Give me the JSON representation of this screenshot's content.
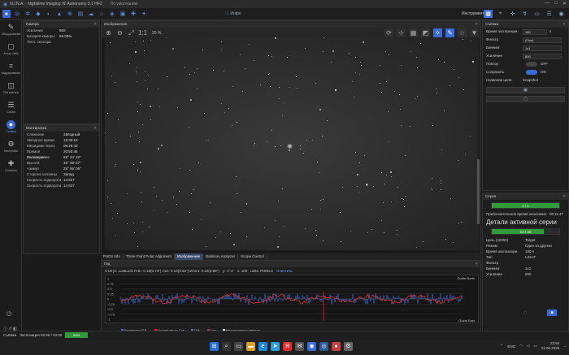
{
  "app": {
    "title": "N.I.N.A. - Nighttime Imaging 'N' Astronomy 3.1 HF2",
    "subtitle": "По умолчанию"
  },
  "toolbar": {
    "info_label": "Инфо",
    "instruments_label": "Инструменты"
  },
  "sidebar": {
    "items": [
      {
        "label": "Оборудование"
      },
      {
        "label": "Атлас неба"
      },
      {
        "label": "Кадрирование"
      },
      {
        "label": "Flat мастер"
      },
      {
        "label": "Серия"
      },
      {
        "label": "Съёмка"
      },
      {
        "label": "Настройки"
      },
      {
        "label": "Плагины"
      }
    ],
    "active_index": 5
  },
  "camera_panel": {
    "title": "Камера",
    "rows": [
      {
        "k": "Усиление",
        "v": "800"
      },
      {
        "k": "Батарея камеры",
        "v": "65.00%"
      },
      {
        "k": "Тепл. сенсора",
        "v": ""
      }
    ]
  },
  "mount_panel": {
    "title": "Монтировка",
    "rows": [
      {
        "k": "Слежение",
        "v": "Звёздный"
      },
      {
        "k": "Звёздное время",
        "v": "15:30:19"
      },
      {
        "k": "Меридиан через",
        "v": "05:28:40"
      },
      {
        "k": "Прямое Восхождение",
        "v": "20:50:45"
      },
      {
        "k": "Склонение",
        "v": "69° 34' 22\""
      },
      {
        "k": "Высота",
        "v": "46° 08' 57\""
      },
      {
        "k": "Азимут",
        "v": "29° 56' 06\""
      },
      {
        "k": "Сторона колонны",
        "v": "Запад"
      },
      {
        "k": "Скорость подворота",
        "v": "13.537"
      },
      {
        "k": "Скорость подворота",
        "v": "13.537"
      }
    ]
  },
  "image_panel": {
    "title": "Изображение",
    "zoom_label": "1:1",
    "zoom_value": "20 %"
  },
  "tabs": [
    {
      "label": "PHD2 Info",
      "active": false
    },
    {
      "label": "Three Point Polar Alignment",
      "active": false
    },
    {
      "label": "Изображение",
      "active": true
    },
    {
      "label": "Bahtinov Analyzer",
      "active": false
    },
    {
      "label": "Scope Control",
      "active": false
    }
  ],
  "guider": {
    "title": "Гид",
    "stats": "Статус: LostLock  П.В.: 0.18(0.73\")  Скл: 0.13(0.52\")  Итого: 0.22(0.89\")",
    "y_scale": "y: +/-1\"",
    "x_scale": "x: 100",
    "units": "units: PIXELS",
    "clear_label": "Очистить",
    "north_label": "Guide North",
    "east_label": "Guide East",
    "y_ticks": [
      "1",
      "0.75",
      "0.5",
      "0.25",
      "0",
      "-0.25",
      "-0.5",
      "-0.75",
      "-1"
    ],
    "legend": [
      {
        "label": "Коррекция П.В.",
        "color": "#3a6ad8"
      },
      {
        "label": "Коррекция по Скл",
        "color": "#c83030"
      },
      {
        "label": "П.В.",
        "color": "#3a6ad8"
      },
      {
        "label": "Скл",
        "color": "#c83030"
      },
      {
        "label": "Меандровая подвижка",
        "color": "#ffffff"
      }
    ]
  },
  "camera_right": {
    "title": "Съёмка",
    "exposure_label": "Время экспозиции",
    "exposure_value": "180",
    "exposure_unit": "s",
    "filter_label": "Фильтр",
    "filter_value": "(Fixe)",
    "binning_label": "Биннинг",
    "binning_value": "1x1",
    "gain_label": "Усиление",
    "gain_value": "800",
    "loop_label": "Повтор",
    "loop_value": "OFF",
    "save_label": "Сохранить",
    "save_value": "ON",
    "target_label": "Название цели",
    "target_value": "Snapshot"
  },
  "sequence": {
    "title": "Серия",
    "progress_label": "1 / 1",
    "progress": 1.0,
    "eta_label": "Приблизительное время окончания",
    "eta_value": "00:11:47",
    "details_title": "Детали активной серии",
    "active_progress_label": "23 / 30",
    "active_progress": 0.77,
    "rows": [
      {
        "k": "Цель (J2000)",
        "v": "Target"
      },
      {
        "k": "Режим",
        "v": "Один за другим"
      },
      {
        "k": "Время экспозиции",
        "v": "180 s"
      },
      {
        "k": "Тип",
        "v": "LIGHT"
      },
      {
        "k": "Фильтр",
        "v": ""
      },
      {
        "k": "Биннинг",
        "v": "1x1"
      },
      {
        "k": "Усиление",
        "v": "800"
      }
    ]
  },
  "status": {
    "label": "Съёмка",
    "exposure": "Экспозиция 02:35 / 03:00",
    "progress_text": "86%"
  },
  "taskbar": {
    "lang": "ENG",
    "time": "23:50",
    "date": "22.05.2025"
  }
}
